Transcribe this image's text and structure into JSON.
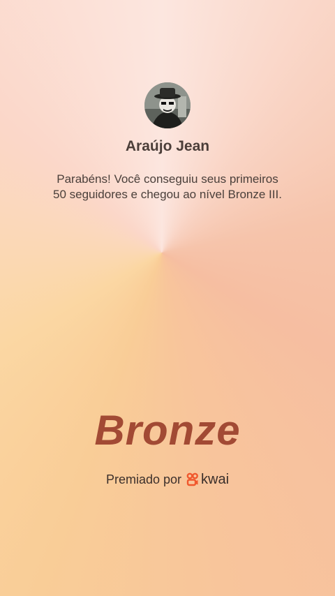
{
  "profile": {
    "name": "Araújo Jean",
    "avatar": "avatar-photo"
  },
  "message": {
    "line1": "Parabéns! Você conseguiu seus primeiros",
    "line2": "50 seguidores e chegou ao nível Bronze III."
  },
  "badge": {
    "tier": "Bronze"
  },
  "footer": {
    "awarded_by": "Premiado por",
    "brand": "kwai",
    "brand_icon": "kwai-logo-icon"
  },
  "colors": {
    "tier_text": "#a24a34",
    "brand_icon": "#f0572c"
  }
}
